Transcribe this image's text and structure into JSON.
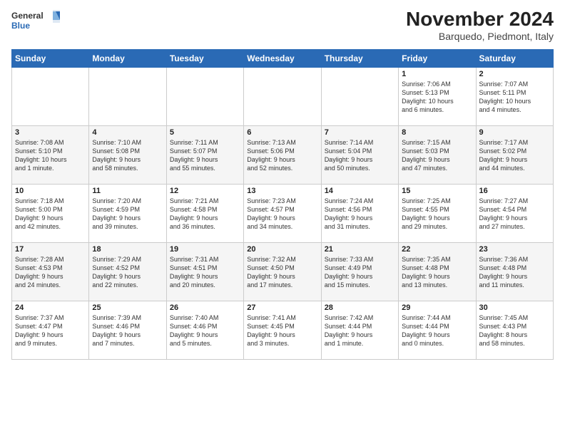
{
  "logo": {
    "general": "General",
    "blue": "Blue"
  },
  "title": "November 2024",
  "subtitle": "Barquedo, Piedmont, Italy",
  "days_header": [
    "Sunday",
    "Monday",
    "Tuesday",
    "Wednesday",
    "Thursday",
    "Friday",
    "Saturday"
  ],
  "weeks": [
    [
      {
        "day": "",
        "info": ""
      },
      {
        "day": "",
        "info": ""
      },
      {
        "day": "",
        "info": ""
      },
      {
        "day": "",
        "info": ""
      },
      {
        "day": "",
        "info": ""
      },
      {
        "day": "1",
        "info": "Sunrise: 7:06 AM\nSunset: 5:13 PM\nDaylight: 10 hours\nand 6 minutes."
      },
      {
        "day": "2",
        "info": "Sunrise: 7:07 AM\nSunset: 5:11 PM\nDaylight: 10 hours\nand 4 minutes."
      }
    ],
    [
      {
        "day": "3",
        "info": "Sunrise: 7:08 AM\nSunset: 5:10 PM\nDaylight: 10 hours\nand 1 minute."
      },
      {
        "day": "4",
        "info": "Sunrise: 7:10 AM\nSunset: 5:08 PM\nDaylight: 9 hours\nand 58 minutes."
      },
      {
        "day": "5",
        "info": "Sunrise: 7:11 AM\nSunset: 5:07 PM\nDaylight: 9 hours\nand 55 minutes."
      },
      {
        "day": "6",
        "info": "Sunrise: 7:13 AM\nSunset: 5:06 PM\nDaylight: 9 hours\nand 52 minutes."
      },
      {
        "day": "7",
        "info": "Sunrise: 7:14 AM\nSunset: 5:04 PM\nDaylight: 9 hours\nand 50 minutes."
      },
      {
        "day": "8",
        "info": "Sunrise: 7:15 AM\nSunset: 5:03 PM\nDaylight: 9 hours\nand 47 minutes."
      },
      {
        "day": "9",
        "info": "Sunrise: 7:17 AM\nSunset: 5:02 PM\nDaylight: 9 hours\nand 44 minutes."
      }
    ],
    [
      {
        "day": "10",
        "info": "Sunrise: 7:18 AM\nSunset: 5:00 PM\nDaylight: 9 hours\nand 42 minutes."
      },
      {
        "day": "11",
        "info": "Sunrise: 7:20 AM\nSunset: 4:59 PM\nDaylight: 9 hours\nand 39 minutes."
      },
      {
        "day": "12",
        "info": "Sunrise: 7:21 AM\nSunset: 4:58 PM\nDaylight: 9 hours\nand 36 minutes."
      },
      {
        "day": "13",
        "info": "Sunrise: 7:23 AM\nSunset: 4:57 PM\nDaylight: 9 hours\nand 34 minutes."
      },
      {
        "day": "14",
        "info": "Sunrise: 7:24 AM\nSunset: 4:56 PM\nDaylight: 9 hours\nand 31 minutes."
      },
      {
        "day": "15",
        "info": "Sunrise: 7:25 AM\nSunset: 4:55 PM\nDaylight: 9 hours\nand 29 minutes."
      },
      {
        "day": "16",
        "info": "Sunrise: 7:27 AM\nSunset: 4:54 PM\nDaylight: 9 hours\nand 27 minutes."
      }
    ],
    [
      {
        "day": "17",
        "info": "Sunrise: 7:28 AM\nSunset: 4:53 PM\nDaylight: 9 hours\nand 24 minutes."
      },
      {
        "day": "18",
        "info": "Sunrise: 7:29 AM\nSunset: 4:52 PM\nDaylight: 9 hours\nand 22 minutes."
      },
      {
        "day": "19",
        "info": "Sunrise: 7:31 AM\nSunset: 4:51 PM\nDaylight: 9 hours\nand 20 minutes."
      },
      {
        "day": "20",
        "info": "Sunrise: 7:32 AM\nSunset: 4:50 PM\nDaylight: 9 hours\nand 17 minutes."
      },
      {
        "day": "21",
        "info": "Sunrise: 7:33 AM\nSunset: 4:49 PM\nDaylight: 9 hours\nand 15 minutes."
      },
      {
        "day": "22",
        "info": "Sunrise: 7:35 AM\nSunset: 4:48 PM\nDaylight: 9 hours\nand 13 minutes."
      },
      {
        "day": "23",
        "info": "Sunrise: 7:36 AM\nSunset: 4:48 PM\nDaylight: 9 hours\nand 11 minutes."
      }
    ],
    [
      {
        "day": "24",
        "info": "Sunrise: 7:37 AM\nSunset: 4:47 PM\nDaylight: 9 hours\nand 9 minutes."
      },
      {
        "day": "25",
        "info": "Sunrise: 7:39 AM\nSunset: 4:46 PM\nDaylight: 9 hours\nand 7 minutes."
      },
      {
        "day": "26",
        "info": "Sunrise: 7:40 AM\nSunset: 4:46 PM\nDaylight: 9 hours\nand 5 minutes."
      },
      {
        "day": "27",
        "info": "Sunrise: 7:41 AM\nSunset: 4:45 PM\nDaylight: 9 hours\nand 3 minutes."
      },
      {
        "day": "28",
        "info": "Sunrise: 7:42 AM\nSunset: 4:44 PM\nDaylight: 9 hours\nand 1 minute."
      },
      {
        "day": "29",
        "info": "Sunrise: 7:44 AM\nSunset: 4:44 PM\nDaylight: 9 hours\nand 0 minutes."
      },
      {
        "day": "30",
        "info": "Sunrise: 7:45 AM\nSunset: 4:43 PM\nDaylight: 8 hours\nand 58 minutes."
      }
    ]
  ]
}
